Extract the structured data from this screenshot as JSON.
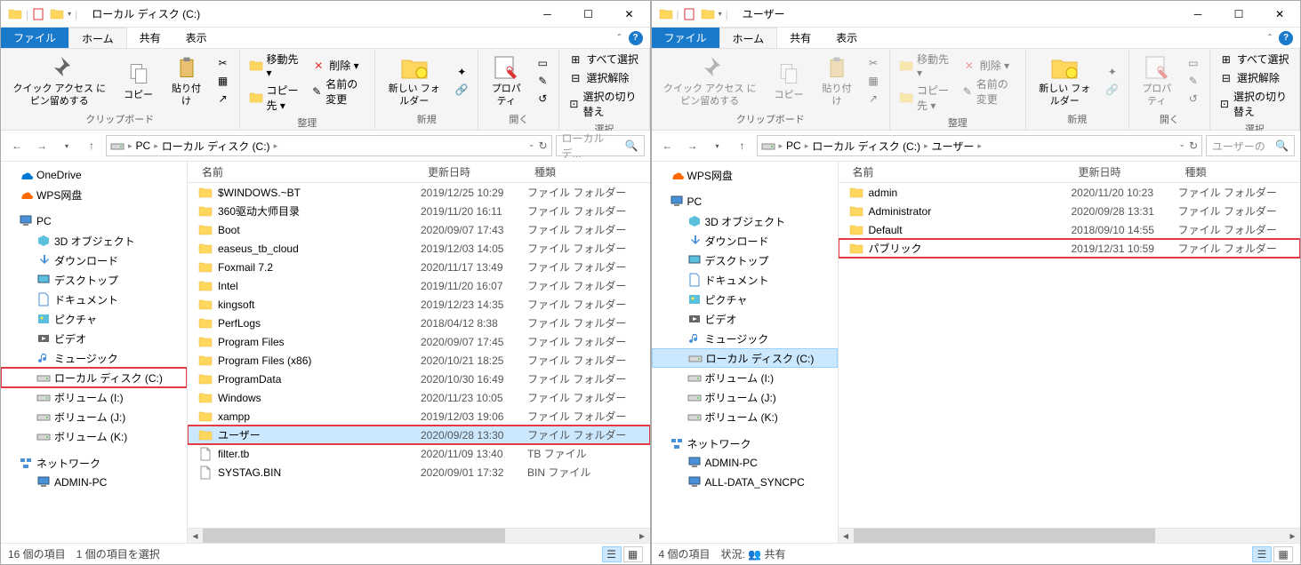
{
  "windows": [
    {
      "title": "ローカル ディスク (C:)",
      "tabs": {
        "file": "ファイル",
        "home": "ホーム",
        "share": "共有",
        "view": "表示"
      },
      "ribbon": {
        "clipboard": {
          "label": "クリップボード",
          "pin": "クイック アクセス\nにピン留めする",
          "copy": "コピー",
          "paste": "貼り付け"
        },
        "organize": {
          "label": "整理",
          "moveTo": "移動先",
          "copyTo": "コピー先",
          "delete": "削除",
          "rename": "名前の変更"
        },
        "new": {
          "label": "新規",
          "newFolder": "新しい\nフォルダー"
        },
        "open": {
          "label": "開く",
          "properties": "プロパ\nティ"
        },
        "select": {
          "label": "選択",
          "selectAll": "すべて選択",
          "selectNone": "選択解除",
          "invert": "選択の切り替え"
        }
      },
      "breadcrumb": [
        "PC",
        "ローカル ディスク (C:)"
      ],
      "searchPlaceholder": "ローカル デ...",
      "columns": {
        "name": "名前",
        "date": "更新日時",
        "type": "種類"
      },
      "tree": [
        {
          "icon": "onedrive",
          "label": "OneDrive",
          "indent": 0
        },
        {
          "icon": "wps",
          "label": "WPS网盘",
          "indent": 0
        },
        {
          "icon": "pc",
          "label": "PC",
          "indent": 0,
          "spacer": true
        },
        {
          "icon": "3d",
          "label": "3D オブジェクト",
          "indent": 1
        },
        {
          "icon": "download",
          "label": "ダウンロード",
          "indent": 1
        },
        {
          "icon": "desktop",
          "label": "デスクトップ",
          "indent": 1
        },
        {
          "icon": "doc",
          "label": "ドキュメント",
          "indent": 1
        },
        {
          "icon": "pic",
          "label": "ピクチャ",
          "indent": 1
        },
        {
          "icon": "video",
          "label": "ビデオ",
          "indent": 1
        },
        {
          "icon": "music",
          "label": "ミュージック",
          "indent": 1
        },
        {
          "icon": "drive",
          "label": "ローカル ディスク (C:)",
          "indent": 1,
          "highlighted": true
        },
        {
          "icon": "drive",
          "label": "ボリューム (I:)",
          "indent": 1
        },
        {
          "icon": "drive",
          "label": "ボリューム (J:)",
          "indent": 1
        },
        {
          "icon": "drive",
          "label": "ボリューム (K:)",
          "indent": 1
        },
        {
          "icon": "network",
          "label": "ネットワーク",
          "indent": 0,
          "spacer": true
        },
        {
          "icon": "pc",
          "label": "ADMIN-PC",
          "indent": 1
        }
      ],
      "files": [
        {
          "icon": "folder",
          "name": "$WINDOWS.~BT",
          "date": "2019/12/25 10:29",
          "type": "ファイル フォルダー"
        },
        {
          "icon": "folder",
          "name": "360驱动大师目录",
          "date": "2019/11/20 16:11",
          "type": "ファイル フォルダー"
        },
        {
          "icon": "folder",
          "name": "Boot",
          "date": "2020/09/07 17:43",
          "type": "ファイル フォルダー"
        },
        {
          "icon": "folder",
          "name": "easeus_tb_cloud",
          "date": "2019/12/03 14:05",
          "type": "ファイル フォルダー"
        },
        {
          "icon": "folder",
          "name": "Foxmail 7.2",
          "date": "2020/11/17 13:49",
          "type": "ファイル フォルダー"
        },
        {
          "icon": "folder",
          "name": "Intel",
          "date": "2019/11/20 16:07",
          "type": "ファイル フォルダー"
        },
        {
          "icon": "folder",
          "name": "kingsoft",
          "date": "2019/12/23 14:35",
          "type": "ファイル フォルダー"
        },
        {
          "icon": "folder",
          "name": "PerfLogs",
          "date": "2018/04/12 8:38",
          "type": "ファイル フォルダー"
        },
        {
          "icon": "folder",
          "name": "Program Files",
          "date": "2020/09/07 17:45",
          "type": "ファイル フォルダー"
        },
        {
          "icon": "folder",
          "name": "Program Files (x86)",
          "date": "2020/10/21 18:25",
          "type": "ファイル フォルダー"
        },
        {
          "icon": "folder",
          "name": "ProgramData",
          "date": "2020/10/30 16:49",
          "type": "ファイル フォルダー"
        },
        {
          "icon": "folder",
          "name": "Windows",
          "date": "2020/11/23 10:05",
          "type": "ファイル フォルダー"
        },
        {
          "icon": "folder",
          "name": "xampp",
          "date": "2019/12/03 19:06",
          "type": "ファイル フォルダー"
        },
        {
          "icon": "folder",
          "name": "ユーザー",
          "date": "2020/09/28 13:30",
          "type": "ファイル フォルダー",
          "selected": true,
          "highlighted": true
        },
        {
          "icon": "file",
          "name": "filter.tb",
          "date": "2020/11/09 13:40",
          "type": "TB ファイル"
        },
        {
          "icon": "file",
          "name": "SYSTAG.BIN",
          "date": "2020/09/01 17:32",
          "type": "BIN ファイル"
        }
      ],
      "status": {
        "count": "16 個の項目",
        "selected": "1 個の項目を選択"
      }
    },
    {
      "title": "ユーザー",
      "tabs": {
        "file": "ファイル",
        "home": "ホーム",
        "share": "共有",
        "view": "表示"
      },
      "ribbon": {
        "clipboard": {
          "label": "クリップボード",
          "pin": "クイック アクセス\nにピン留めする",
          "copy": "コピー",
          "paste": "貼り付け"
        },
        "organize": {
          "label": "整理",
          "moveTo": "移動先",
          "copyTo": "コピー先",
          "delete": "削除",
          "rename": "名前の変更"
        },
        "new": {
          "label": "新規",
          "newFolder": "新しい\nフォルダー"
        },
        "open": {
          "label": "開く",
          "properties": "プロパ\nティ"
        },
        "select": {
          "label": "選択",
          "selectAll": "すべて選択",
          "selectNone": "選択解除",
          "invert": "選択の切り替え"
        }
      },
      "ribbonDisabled": true,
      "breadcrumb": [
        "PC",
        "ローカル ディスク (C:)",
        "ユーザー"
      ],
      "searchPlaceholder": "ユーザーの",
      "columns": {
        "name": "名前",
        "date": "更新日時",
        "type": "種類"
      },
      "tree": [
        {
          "icon": "wps",
          "label": "WPS网盘",
          "indent": 0
        },
        {
          "icon": "pc",
          "label": "PC",
          "indent": 0,
          "spacer": true
        },
        {
          "icon": "3d",
          "label": "3D オブジェクト",
          "indent": 1
        },
        {
          "icon": "download",
          "label": "ダウンロード",
          "indent": 1
        },
        {
          "icon": "desktop",
          "label": "デスクトップ",
          "indent": 1
        },
        {
          "icon": "doc",
          "label": "ドキュメント",
          "indent": 1
        },
        {
          "icon": "pic",
          "label": "ピクチャ",
          "indent": 1
        },
        {
          "icon": "video",
          "label": "ビデオ",
          "indent": 1
        },
        {
          "icon": "music",
          "label": "ミュージック",
          "indent": 1
        },
        {
          "icon": "drive",
          "label": "ローカル ディスク (C:)",
          "indent": 1,
          "selected": true
        },
        {
          "icon": "drive",
          "label": "ボリューム (I:)",
          "indent": 1
        },
        {
          "icon": "drive",
          "label": "ボリューム (J:)",
          "indent": 1
        },
        {
          "icon": "drive",
          "label": "ボリューム (K:)",
          "indent": 1
        },
        {
          "icon": "network",
          "label": "ネットワーク",
          "indent": 0,
          "spacer": true
        },
        {
          "icon": "pc",
          "label": "ADMIN-PC",
          "indent": 1
        },
        {
          "icon": "pc",
          "label": "ALL-DATA_SYNCPC",
          "indent": 1
        }
      ],
      "files": [
        {
          "icon": "folder",
          "name": "admin",
          "date": "2020/11/20 10:23",
          "type": "ファイル フォルダー"
        },
        {
          "icon": "folder",
          "name": "Administrator",
          "date": "2020/09/28 13:31",
          "type": "ファイル フォルダー"
        },
        {
          "icon": "folder",
          "name": "Default",
          "date": "2018/09/10 14:55",
          "type": "ファイル フォルダー"
        },
        {
          "icon": "folder",
          "name": "パブリック",
          "date": "2019/12/31 10:59",
          "type": "ファイル フォルダー",
          "highlighted": true
        }
      ],
      "status": {
        "count": "4 個の項目",
        "state": "状況:",
        "shared": "共有"
      }
    }
  ]
}
